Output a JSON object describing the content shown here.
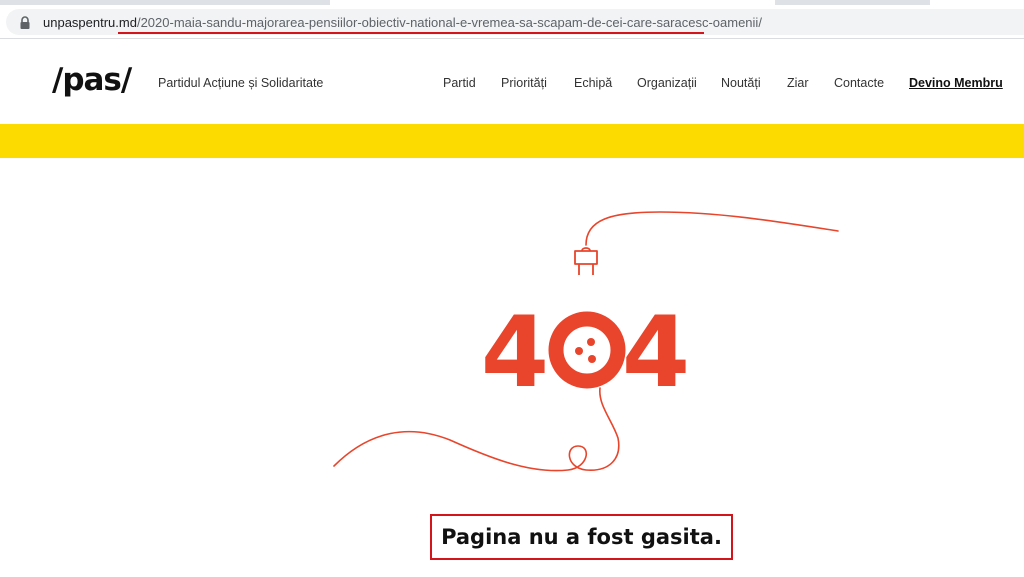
{
  "browser": {
    "url_domain": "unpaspentru.md",
    "url_path": "/2020-maia-sandu-majorarea-pensiilor-obiectiv-national-e-vremea-sa-scapam-de-cei-care-saracesc-oamenii/",
    "lock_icon": "lock-icon"
  },
  "header": {
    "logo": "/pas/",
    "party_name": "Partidul Acțiune și Solidaritate",
    "nav": [
      "Partid",
      "Priorități",
      "Echipă",
      "Organizații",
      "Noutăți",
      "Ziar",
      "Contacte"
    ],
    "cta": "Devino Membru"
  },
  "error": {
    "code_left": "4",
    "code_right": "4",
    "message": "Pagina nu a fost gasita.",
    "accent_color": "#e8452c"
  },
  "colors": {
    "brand_yellow": "#fcdc00",
    "highlight_red": "#d3151b"
  }
}
